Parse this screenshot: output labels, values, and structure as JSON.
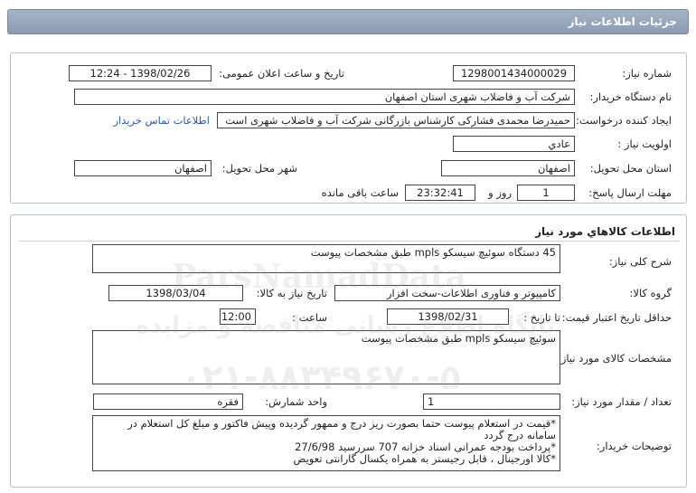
{
  "header": {
    "title": "جزئیات اطلاعات نیاز"
  },
  "need_info": {
    "need_number_label": "شماره نیاز:",
    "need_number": "1298001434000029",
    "announce_label": "تاریخ و ساعت اعلان عمومی:",
    "announce_value": "1398/02/26 - 12:24",
    "buyer_label": "نام دستگاه خریدار:",
    "buyer_value": "شرکت آب و فاضلاب شهری استان اصفهان",
    "creator_label": "ایجاد کننده درخواست:",
    "creator_value": "حمیدرضا محمدی فشارکی کارشناس بازرگانی شرکت آب و فاضلاب شهری است",
    "contact_link": "اطلاعات تماس خریدار",
    "priority_label": "اولویت نیاز :",
    "priority_value": "عادي",
    "delivery_place_label": "استان محل تحویل:",
    "delivery_place_value": "اصفهان",
    "delivery_city_label": "شهر محل تحویل:",
    "delivery_city_value": "اصفهان",
    "deadline_label": "مهلت ارسال پاسخ:",
    "deadline_days": "1",
    "days_word": "روز و",
    "deadline_time": "23:32:41",
    "remaining_word": "ساعت باقی مانده"
  },
  "goods": {
    "section_title": "اطلاعات كالاهاي مورد نياز",
    "summary_label": "شرح کلی نیاز:",
    "summary_value": "45 دستگاه سوئیچ سیسکو mpls طبق مشخصات پیوست",
    "group_label": "گروه کالا:",
    "group_value": "کامپیوتر و فناوری اطلاعات-سخت افزار",
    "need_date_label": "تاریخ نیاز به کالا:",
    "need_date_value": "1398/03/04",
    "validity_label": "حداقل تاریخ اعتبار قیمت:",
    "until_date_label": "تا تاریخ :",
    "until_date_value": "1398/02/31",
    "time_label": "ساعت :",
    "time_value": "12:00",
    "spec_label": "مشخصات کالای مورد نیاز:",
    "spec_value": "سوئیچ سیسکو mpls طبق مشخصات پیوست",
    "qty_label": "تعداد / مقدار مورد نیاز:",
    "qty_value": "1",
    "unit_label": "واحد شمارش:",
    "unit_value": "فقره",
    "notes_label": "توضیحات خریدار:",
    "notes_lines": [
      "*قیمت در استعلام پیوست حتما  بصورت ریز درج  و ممهور گردیده وپیش فاکتور  و مبلغ کل استعلام در",
      "سامانه درج گردد",
      "*پرداخت بودجه عمرانی اسناد خزانه 707 سررسید 27/6/98",
      "*کالا اورجینال ، قابل رجیستر به همراه یکسال گارانتی تعویض"
    ]
  },
  "watermark": {
    "brand": "ParsNamadData",
    "line1": "پایگاه اطلاع رسانی مناقصه و مزایده",
    "phone": "۰۲۱-۸۸۳۴۹۶۷۰-۵"
  }
}
